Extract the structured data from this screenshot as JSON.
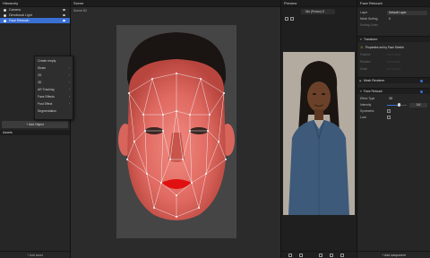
{
  "hierarchy": {
    "title": "Hierarchy",
    "items": [
      {
        "label": "Camera"
      },
      {
        "label": "Directional Light"
      },
      {
        "label": "Face Retouch"
      }
    ],
    "context_menu": [
      {
        "label": "Create empty",
        "submenu": false
      },
      {
        "label": "Share",
        "submenu": true
      },
      {
        "label": "2D",
        "submenu": true
      },
      {
        "label": "3D",
        "submenu": true
      },
      {
        "label": "AR Tracking",
        "submenu": true
      },
      {
        "label": "Face Effects",
        "submenu": true
      },
      {
        "label": "Post Effect",
        "submenu": true
      },
      {
        "label": "Segmentation",
        "submenu": false
      }
    ],
    "add_object": "+ Add Object"
  },
  "assets": {
    "title": "Assets",
    "add_asset": "+ Add asset"
  },
  "scene": {
    "title": "Scene",
    "toolbar_label": "Scene 3D"
  },
  "preview": {
    "title": "Preview",
    "device": "Mix (Person) 8"
  },
  "inspector": {
    "title": "Face Retouch",
    "layer_label": "Layer",
    "layer_value": "Default Layer",
    "mesh_sorting_label": "Mesh Sorting",
    "mesh_sorting_value": "0",
    "sorting_order_label": "Sorting Order",
    "transform_title": "Transform",
    "warning": "Properties set by Face Stretch",
    "dim_rows": [
      {
        "label": "Position",
        "values": "X 0   Y 0   Z 0"
      },
      {
        "label": "Rotation",
        "values": "X 0   Y 0   Z 0"
      },
      {
        "label": "Scale",
        "values": "X 1   Y 1   Z 1"
      }
    ],
    "mesh_renderer_title": "Mesh Renderer",
    "face_retouch_title": "Face Retouch",
    "effect_type_label": "Effect Type",
    "effect_type_value": "3D",
    "intensity_label": "Intensity",
    "intensity_value": 0.6,
    "symmetric_label": "Symmetric",
    "lock_label": "Lock",
    "add_component": "+ Add component"
  },
  "colors": {
    "accent": "#3a6fd4",
    "panel": "#262626",
    "background": "#1f1f1f",
    "warning": "#e0b400"
  }
}
